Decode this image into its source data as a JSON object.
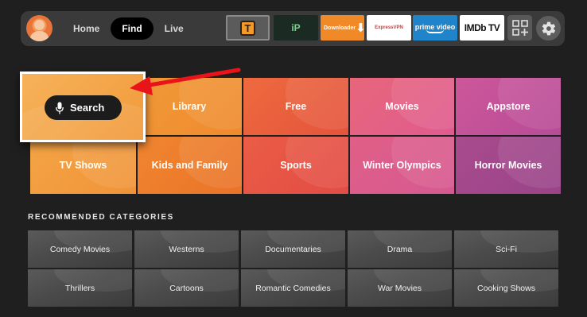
{
  "nav": {
    "items": [
      {
        "label": "Home",
        "active": false
      },
      {
        "label": "Find",
        "active": true
      },
      {
        "label": "Live",
        "active": false
      }
    ]
  },
  "apps": {
    "t_app": "T",
    "ip_app_logo": "iP",
    "downloader": "Downloader",
    "expressvpn": "ExpressVPN",
    "primevideo": "prime video",
    "imdbtv": "IMDb TV"
  },
  "search": {
    "label": "Search"
  },
  "categories": {
    "row1": [
      "Library",
      "Free",
      "Movies",
      "Appstore"
    ],
    "row2": [
      "TV Shows",
      "Kids and Family",
      "Sports",
      "Winter Olympics",
      "Horror Movies"
    ]
  },
  "recommended": {
    "title": "RECOMMENDED CATEGORIES",
    "row1": [
      "Comedy Movies",
      "Westerns",
      "Documentaries",
      "Drama",
      "Sci-Fi"
    ],
    "row2": [
      "Thrillers",
      "Cartoons",
      "Romantic Comedies",
      "War Movies",
      "Cooking Shows"
    ]
  },
  "colors": {
    "orange": "#f08a2e",
    "red": "#ea5a46",
    "pink": "#de5d8d",
    "purple": "#b54e94",
    "arrow": "#e8141a"
  },
  "icons": {
    "settings": "gear-icon",
    "apps": "app-grid-icon",
    "mic": "microphone-icon",
    "profile": "avatar"
  }
}
